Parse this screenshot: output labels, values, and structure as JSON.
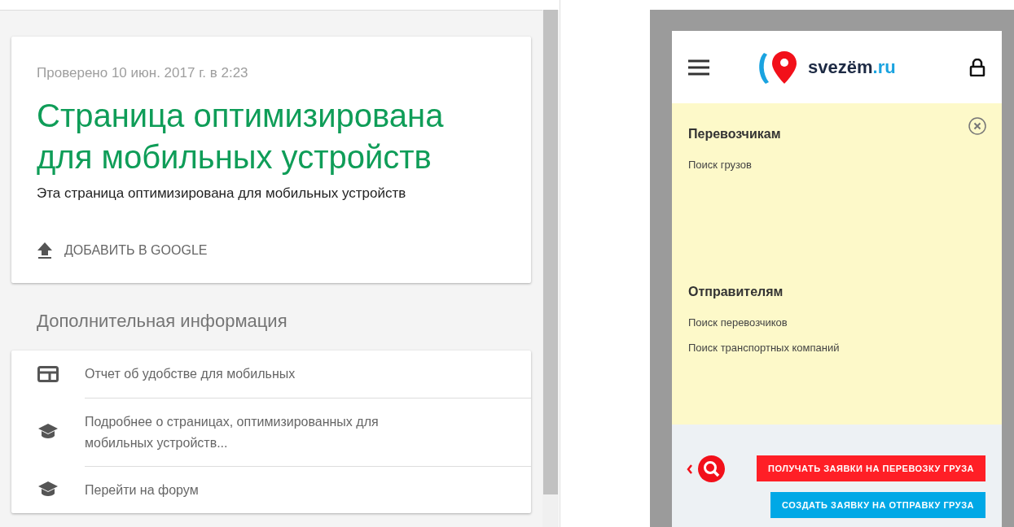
{
  "result_card": {
    "checked_at": "Проверено 10 июн. 2017 г. в 2:23",
    "title": "Страница оптимизирована для мобильных устройств",
    "description": "Эта страница оптимизирована для мобильных устройств",
    "action": "ДОБАВИТЬ В GOOGLE"
  },
  "additional": {
    "heading": "Дополнительная информация",
    "links": [
      {
        "kind": "report",
        "label": "Отчет об удобстве для мобильных"
      },
      {
        "kind": "learn",
        "label": "Подробнее о страницах, оптимизированных для мобильных устройств..."
      },
      {
        "kind": "learn",
        "label": "Перейти на форум"
      }
    ]
  },
  "preview": {
    "logo": {
      "name": "svezëm",
      "domain": ".ru"
    },
    "menu_sections": [
      {
        "title": "Перевозчикам",
        "links": [
          "Поиск грузов"
        ]
      },
      {
        "title": "Отправителям",
        "links": [
          "Поиск перевозчиков",
          "Поиск транспортных компаний"
        ]
      }
    ],
    "buttons": [
      {
        "label": "ПОЛУЧАТЬ ЗАЯВКИ НА ПЕРЕВОЗКУ ГРУЗА",
        "color": "#ff1f26"
      },
      {
        "label": "СОЗДАТЬ ЗАЯВКУ НА ОТПРАВКУ ГРУЗА",
        "color": "#00a8e6"
      }
    ]
  }
}
